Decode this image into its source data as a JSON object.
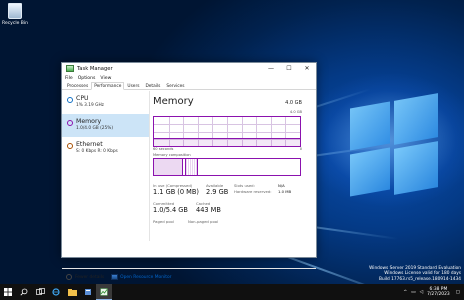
{
  "desktop": {
    "recycle_bin_label": "Recycle Bin",
    "watermark_lines": [
      "Windows Server 2019 Standard Evaluation",
      "Windows License valid for 180 days",
      "Build 17763.rs5_release.180914-1434"
    ]
  },
  "window": {
    "title": "Task Manager",
    "minimize": "—",
    "maximize": "☐",
    "close": "✕",
    "menu": [
      "File",
      "Options",
      "View"
    ],
    "tabs": [
      "Processes",
      "Performance",
      "Users",
      "Details",
      "Services"
    ],
    "active_tab": "Performance"
  },
  "sidebar": {
    "items": [
      {
        "name": "CPU",
        "detail": "1% 3.19 GHz"
      },
      {
        "name": "Memory",
        "detail": "1.0/4.0 GB (25%)"
      },
      {
        "name": "Ethernet",
        "detail": "S: 0 Kbps R: 0 Kbps"
      }
    ],
    "selected": "Memory"
  },
  "memory": {
    "title": "Memory",
    "total": "4.0 GB",
    "usage_label": "Memory usage",
    "usage_max": "4.0 GB",
    "axis_left": "60 seconds",
    "axis_right": "0",
    "usage_fraction": 0.25,
    "composition_label": "Memory composition",
    "stats": {
      "in_use_label": "In use (Compressed)",
      "in_use_value": "1.1 GB (0 MB)",
      "available_label": "Available",
      "available_value": "2.9 GB",
      "committed_label": "Committed",
      "committed_value": "1.0/5.4 GB",
      "cached_label": "Cached",
      "cached_value": "443 MB",
      "paged_pool_label": "Paged pool",
      "non_paged_pool_label": "Non-paged pool",
      "slots_used_label": "Slots used:",
      "slots_used_value": "N/A",
      "hw_reserved_label": "Hardware reserved:",
      "hw_reserved_value": "1.0 MB"
    }
  },
  "footer": {
    "fewer_details": "Fewer details",
    "open_resmon": "Open Resource Monitor"
  },
  "taskbar": {
    "start_icon": "windows-logo-icon",
    "clock_time": "6:38 PM",
    "clock_date": "7/27/2023"
  },
  "colors": {
    "accent": "#8b12ae",
    "selected": "#cce4f7",
    "link": "#0066cc"
  }
}
